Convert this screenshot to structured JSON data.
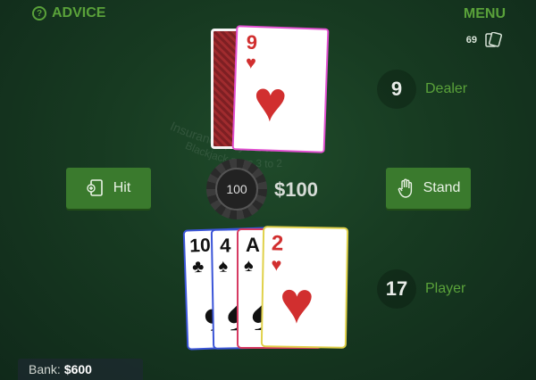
{
  "topbar": {
    "advice_label": "ADVICE",
    "menu_label": "MENU",
    "deck_count": "69"
  },
  "felt": {
    "line1": "Insurance pays 2 to 1",
    "line2": "Blackjack pays 3 to 2"
  },
  "dealer": {
    "score": "9",
    "label": "Dealer",
    "card": {
      "rank": "9",
      "suit": "♥",
      "color": "red"
    }
  },
  "player": {
    "score": "17",
    "label": "Player",
    "cards": [
      {
        "rank": "10",
        "suit": "♣",
        "color": "black"
      },
      {
        "rank": "4",
        "suit": "♠",
        "color": "black"
      },
      {
        "rank": "A",
        "suit": "♠",
        "color": "black"
      },
      {
        "rank": "2",
        "suit": "♥",
        "color": "red"
      }
    ]
  },
  "actions": {
    "hit_label": "Hit",
    "stand_label": "Stand"
  },
  "bet": {
    "chip_value": "100",
    "amount": "$100"
  },
  "bank": {
    "label": "Bank:",
    "value": "$600"
  },
  "colors": {
    "felt": "#173a21",
    "accent_green": "#5aa23a",
    "button_green": "#3a7a2d",
    "heart_red": "#d12f2f"
  }
}
